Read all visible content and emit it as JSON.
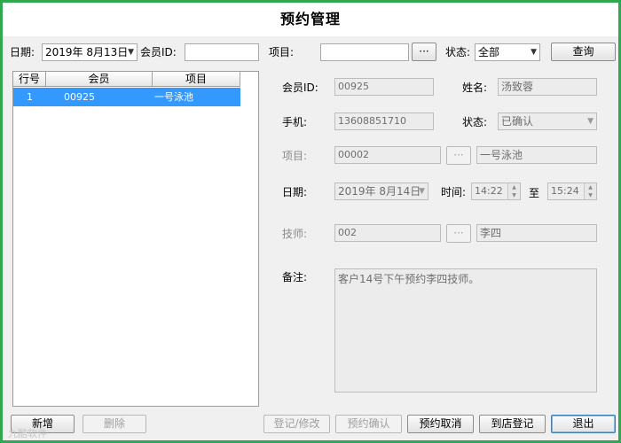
{
  "window": {
    "title": "预约管理"
  },
  "search": {
    "date_label": "日期:",
    "date_value": "2019年 8月13日",
    "member_id_label": "会员ID:",
    "member_id_value": "",
    "project_label": "项目:",
    "project_value": "",
    "browse_label": "···",
    "status_label": "状态:",
    "status_value": "全部",
    "query_label": "查询"
  },
  "grid": {
    "columns": [
      "行号",
      "会员",
      "项目"
    ],
    "rows": [
      {
        "row_no": "1",
        "member": "00925",
        "project": "一号泳池"
      }
    ]
  },
  "detail": {
    "member_id_label": "会员ID:",
    "member_id_value": "00925",
    "name_label": "姓名:",
    "name_value": "汤致蓉",
    "phone_label": "手机:",
    "phone_value": "13608851710",
    "status_label": "状态:",
    "status_value": "已确认",
    "project_label": "项目:",
    "project_code": "00002",
    "project_browse": "···",
    "project_name": "一号泳池",
    "date_label": "日期:",
    "date_value": "2019年 8月14日",
    "time_label": "时间:",
    "time_from": "14:22",
    "to_label": "至",
    "time_to": "15:24",
    "tech_label": "技师:",
    "tech_code": "002",
    "tech_browse": "···",
    "tech_name": "李四",
    "note_label": "备注:",
    "note_value": "客户14号下午预约李四技师。"
  },
  "actions": {
    "new": "新增",
    "delete": "删除",
    "edit": "登记/修改",
    "confirm": "预约确认",
    "cancel": "预约取消",
    "arrive": "到店登记",
    "exit": "退出"
  },
  "watermark": "九酷软件"
}
